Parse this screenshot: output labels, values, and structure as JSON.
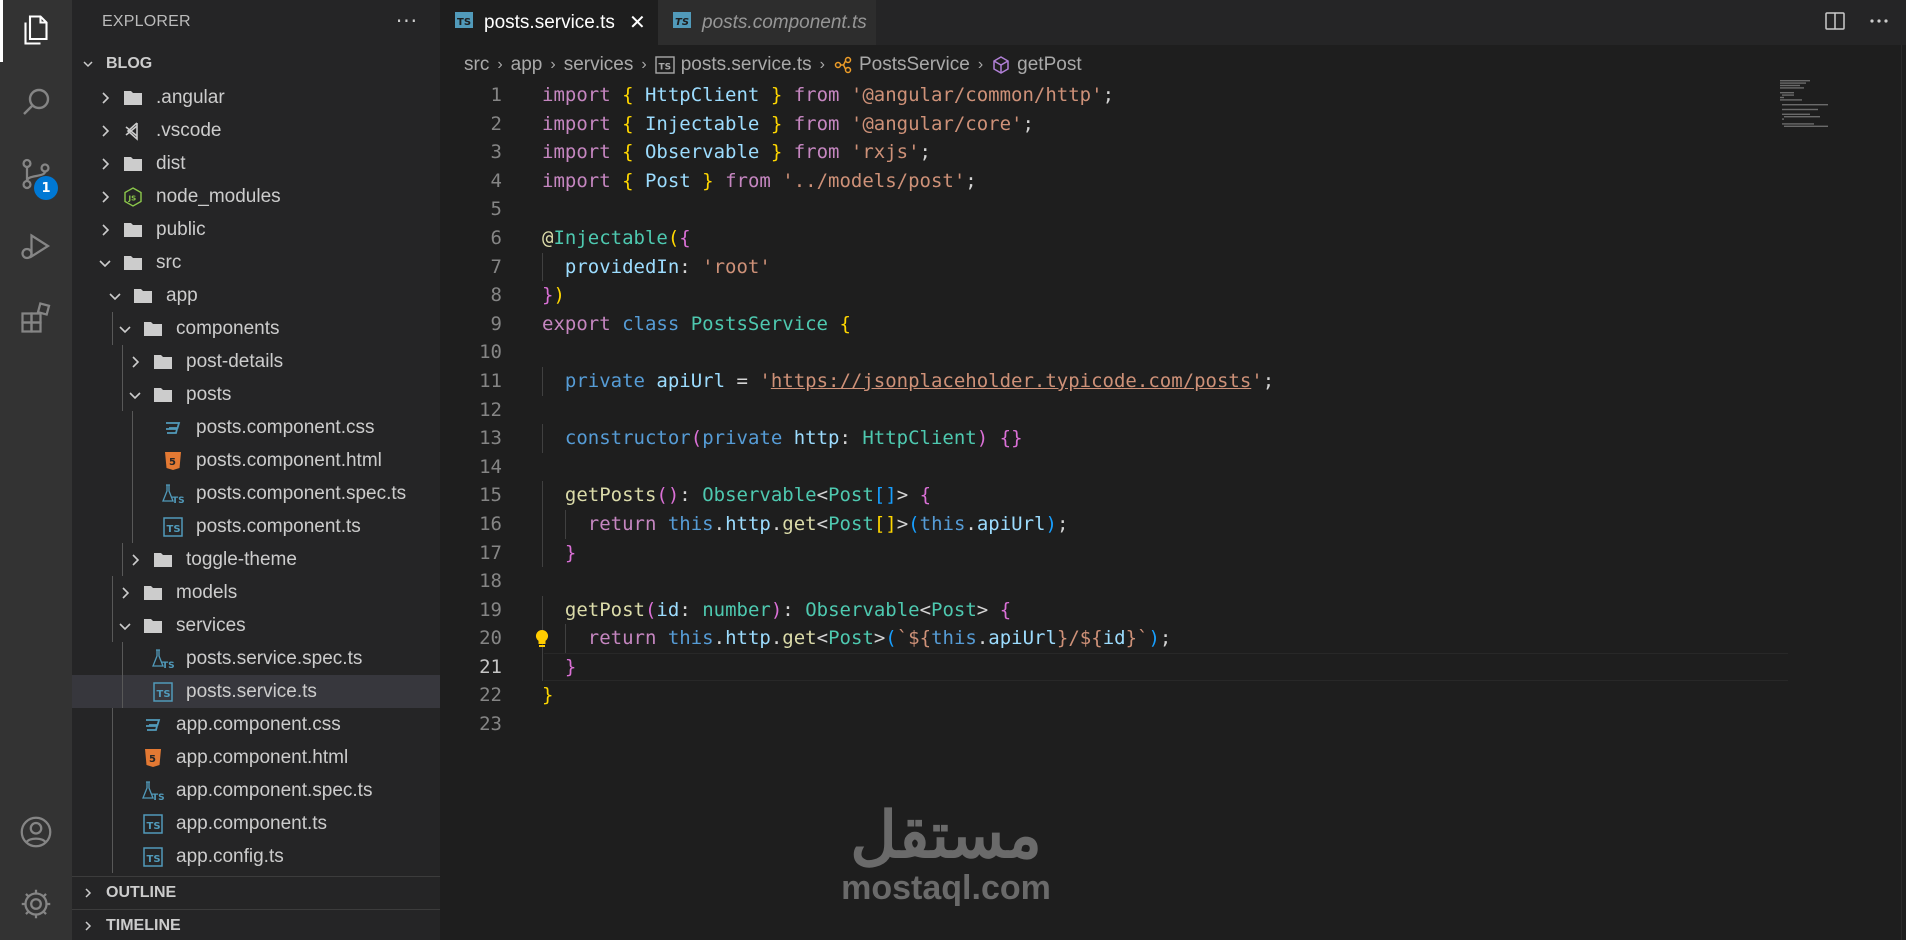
{
  "sidebar": {
    "title": "EXPLORER",
    "more": "···",
    "project": "BLOG",
    "tree": [
      {
        "label": ".angular",
        "level": 0,
        "kind": "folder",
        "open": false
      },
      {
        "label": ".vscode",
        "level": 0,
        "kind": "vscode",
        "open": false
      },
      {
        "label": "dist",
        "level": 0,
        "kind": "folder",
        "open": false
      },
      {
        "label": "node_modules",
        "level": 0,
        "kind": "node",
        "open": false
      },
      {
        "label": "public",
        "level": 0,
        "kind": "folder",
        "open": false
      },
      {
        "label": "src",
        "level": 0,
        "kind": "folder",
        "open": true
      },
      {
        "label": "app",
        "level": 1,
        "kind": "folder",
        "open": true
      },
      {
        "label": "components",
        "level": 2,
        "kind": "folder",
        "open": true
      },
      {
        "label": "post-details",
        "level": 3,
        "kind": "folder",
        "open": false
      },
      {
        "label": "posts",
        "level": 3,
        "kind": "folder",
        "open": true
      },
      {
        "label": "posts.component.css",
        "level": 4,
        "kind": "css"
      },
      {
        "label": "posts.component.html",
        "level": 4,
        "kind": "html"
      },
      {
        "label": "posts.component.spec.ts",
        "level": 4,
        "kind": "spec"
      },
      {
        "label": "posts.component.ts",
        "level": 4,
        "kind": "ts"
      },
      {
        "label": "toggle-theme",
        "level": 3,
        "kind": "folder",
        "open": false
      },
      {
        "label": "models",
        "level": 2,
        "kind": "folder",
        "open": false
      },
      {
        "label": "services",
        "level": 2,
        "kind": "folder",
        "open": true
      },
      {
        "label": "posts.service.spec.ts",
        "level": 3,
        "kind": "spec"
      },
      {
        "label": "posts.service.ts",
        "level": 3,
        "kind": "ts",
        "selected": true
      },
      {
        "label": "app.component.css",
        "level": 2,
        "kind": "css"
      },
      {
        "label": "app.component.html",
        "level": 2,
        "kind": "html"
      },
      {
        "label": "app.component.spec.ts",
        "level": 2,
        "kind": "spec"
      },
      {
        "label": "app.component.ts",
        "level": 2,
        "kind": "ts"
      },
      {
        "label": "app.config.ts",
        "level": 2,
        "kind": "ts"
      }
    ],
    "outline": "OUTLINE",
    "timeline": "TIMELINE"
  },
  "activity": {
    "scm_badge": "1"
  },
  "tabs": [
    {
      "label": "posts.service.ts",
      "active": true,
      "close": "✕"
    },
    {
      "label": "posts.component.ts",
      "active": false
    }
  ],
  "breadcrumbs": [
    "src",
    "app",
    "services",
    "posts.service.ts",
    "PostsService",
    "getPost"
  ],
  "editor": {
    "active_line": 21,
    "lines": [
      [
        [
          "import ",
          "kw"
        ],
        [
          "{ ",
          "b1"
        ],
        [
          "HttpClient ",
          "id"
        ],
        [
          "} ",
          "b1"
        ],
        [
          "from ",
          "kw"
        ],
        [
          "'@angular/common/http'",
          "str"
        ],
        [
          ";",
          ""
        ]
      ],
      [
        [
          "import ",
          "kw"
        ],
        [
          "{ ",
          "b1"
        ],
        [
          "Injectable ",
          "id"
        ],
        [
          "} ",
          "b1"
        ],
        [
          "from ",
          "kw"
        ],
        [
          "'@angular/core'",
          "str"
        ],
        [
          ";",
          ""
        ]
      ],
      [
        [
          "import ",
          "kw"
        ],
        [
          "{ ",
          "b1"
        ],
        [
          "Observable ",
          "id"
        ],
        [
          "} ",
          "b1"
        ],
        [
          "from ",
          "kw"
        ],
        [
          "'rxjs'",
          "str"
        ],
        [
          ";",
          ""
        ]
      ],
      [
        [
          "import ",
          "kw"
        ],
        [
          "{ ",
          "b1"
        ],
        [
          "Post ",
          "id"
        ],
        [
          "} ",
          "b1"
        ],
        [
          "from ",
          "kw"
        ],
        [
          "'../models/post'",
          "str"
        ],
        [
          ";",
          ""
        ]
      ],
      [],
      [
        [
          "@",
          "fn"
        ],
        [
          "Injectable",
          "cls"
        ],
        [
          "(",
          "b1"
        ],
        [
          "{",
          "b2"
        ]
      ],
      [
        [
          "  ",
          ""
        ],
        [
          "providedIn",
          "id"
        ],
        [
          ": ",
          ""
        ],
        [
          "'root'",
          "str"
        ]
      ],
      [
        [
          "}",
          "b2"
        ],
        [
          ")",
          "b1"
        ]
      ],
      [
        [
          "export ",
          "kw"
        ],
        [
          "class ",
          "sk"
        ],
        [
          "PostsService ",
          "cls"
        ],
        [
          "{",
          "b1"
        ]
      ],
      [],
      [
        [
          "  ",
          ""
        ],
        [
          "private ",
          "sk"
        ],
        [
          "apiUrl ",
          "id"
        ],
        [
          "= ",
          ""
        ],
        [
          "'",
          "str"
        ],
        [
          "https://jsonplaceholder.typicode.com/posts",
          "str link"
        ],
        [
          "'",
          "str"
        ],
        [
          ";",
          ""
        ]
      ],
      [],
      [
        [
          "  ",
          ""
        ],
        [
          "constructor",
          "sk"
        ],
        [
          "(",
          "b2"
        ],
        [
          "private ",
          "sk"
        ],
        [
          "http",
          "id"
        ],
        [
          ": ",
          ""
        ],
        [
          "HttpClient",
          "cls"
        ],
        [
          ") ",
          "b2"
        ],
        [
          "{}",
          "b2"
        ]
      ],
      [],
      [
        [
          "  ",
          ""
        ],
        [
          "getPosts",
          "fn"
        ],
        [
          "()",
          "b2"
        ],
        [
          ": ",
          ""
        ],
        [
          "Observable",
          "cls"
        ],
        [
          "<",
          ""
        ],
        [
          "Post",
          "cls"
        ],
        [
          "[]",
          "b3"
        ],
        [
          "> ",
          ""
        ],
        [
          "{",
          "b2"
        ]
      ],
      [
        [
          "    ",
          ""
        ],
        [
          "return ",
          "kw"
        ],
        [
          "this",
          "sk"
        ],
        [
          ".",
          ""
        ],
        [
          "http",
          "id"
        ],
        [
          ".",
          ""
        ],
        [
          "get",
          "fn"
        ],
        [
          "<",
          ""
        ],
        [
          "Post",
          "cls"
        ],
        [
          "[]",
          "b1"
        ],
        [
          ">",
          ""
        ],
        [
          "(",
          "b3"
        ],
        [
          "this",
          "sk"
        ],
        [
          ".",
          ""
        ],
        [
          "apiUrl",
          "id"
        ],
        [
          ")",
          "b3"
        ],
        [
          ";",
          ""
        ]
      ],
      [
        [
          "  ",
          ""
        ],
        [
          "}",
          "b2"
        ]
      ],
      [],
      [
        [
          "  ",
          ""
        ],
        [
          "getPost",
          "fn"
        ],
        [
          "(",
          "b2"
        ],
        [
          "id",
          "id"
        ],
        [
          ": ",
          ""
        ],
        [
          "number",
          "cls"
        ],
        [
          ")",
          "b2"
        ],
        [
          ": ",
          ""
        ],
        [
          "Observable",
          "cls"
        ],
        [
          "<",
          ""
        ],
        [
          "Post",
          "cls"
        ],
        [
          "> ",
          ""
        ],
        [
          "{",
          "b2"
        ]
      ],
      [
        [
          "    ",
          ""
        ],
        [
          "return ",
          "kw"
        ],
        [
          "this",
          "sk"
        ],
        [
          ".",
          ""
        ],
        [
          "http",
          "id"
        ],
        [
          ".",
          ""
        ],
        [
          "get",
          "fn"
        ],
        [
          "<",
          ""
        ],
        [
          "Post",
          "cls"
        ],
        [
          ">",
          ""
        ],
        [
          "(",
          "b3"
        ],
        [
          "`${",
          "str"
        ],
        [
          "this",
          "sk"
        ],
        [
          ".",
          ""
        ],
        [
          "apiUrl",
          "id"
        ],
        [
          "}/${",
          "str"
        ],
        [
          "id",
          "id"
        ],
        [
          "}`",
          "str"
        ],
        [
          ")",
          "b3"
        ],
        [
          ";",
          ""
        ]
      ],
      [
        [
          "  ",
          ""
        ],
        [
          "}",
          "b2"
        ]
      ],
      [
        [
          "}",
          "b1"
        ]
      ],
      []
    ]
  },
  "watermark": {
    "arabic": "مستقل",
    "latin": "mostaql.com"
  },
  "colors": {
    "activity_bar": "#333333",
    "sidebar": "#252526",
    "editor": "#1e1e1e",
    "accent": "#0078d4"
  }
}
